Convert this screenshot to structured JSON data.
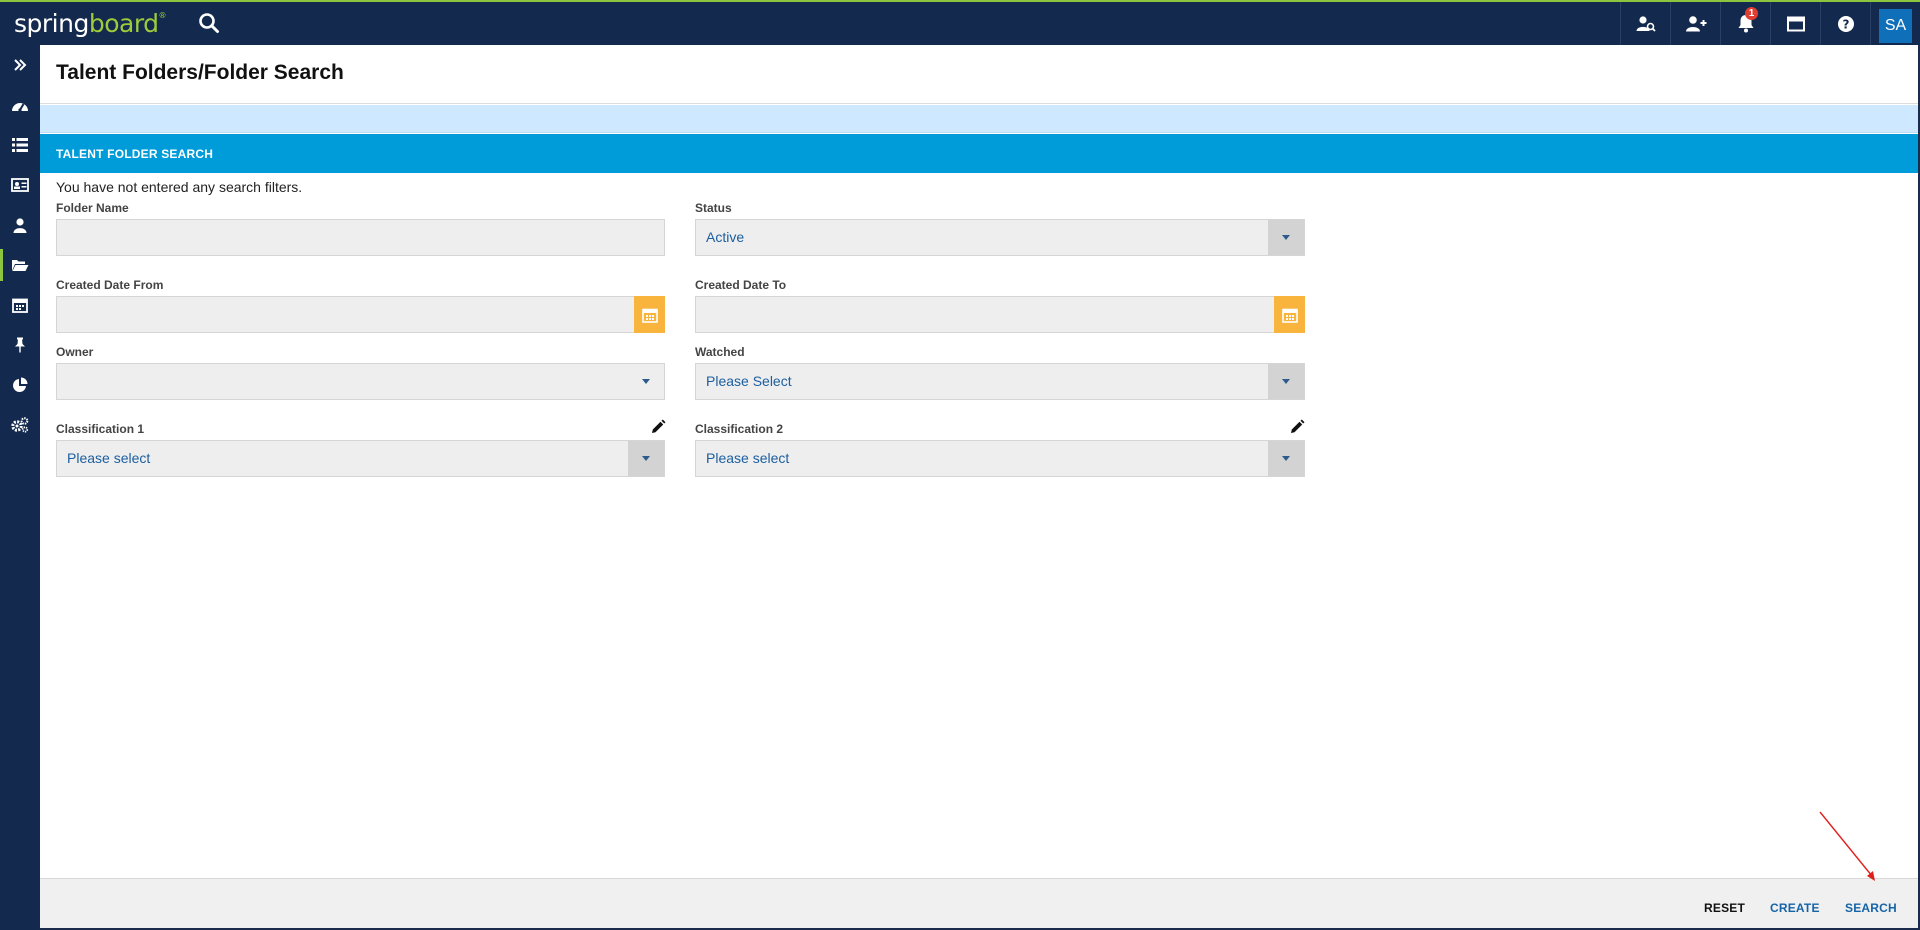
{
  "app": {
    "logo_spring": "spring",
    "logo_board": "board",
    "logo_mark": "®"
  },
  "topbar": {
    "notification_count": "1",
    "avatar_initials": "SA",
    "icons": [
      "user-search-icon",
      "add-user-icon",
      "bell-icon",
      "window-icon",
      "help-icon"
    ]
  },
  "sidebar": {
    "items": [
      "expand-icon",
      "dashboard-icon",
      "list-icon",
      "id-card-icon",
      "person-icon",
      "folder-open-icon",
      "calendar-icon",
      "pin-icon",
      "pie-chart-icon",
      "settings-icon"
    ],
    "active_item": "folder-open-icon"
  },
  "page": {
    "title": "Talent Folders/Folder Search"
  },
  "section": {
    "title": "TALENT FOLDER SEARCH",
    "hint": "You have not entered any search filters."
  },
  "form": {
    "folder_name": {
      "label": "Folder Name",
      "value": ""
    },
    "status": {
      "label": "Status",
      "value": "Active"
    },
    "created_from": {
      "label": "Created Date From",
      "value": ""
    },
    "created_to": {
      "label": "Created Date To",
      "value": ""
    },
    "owner": {
      "label": "Owner",
      "value": ""
    },
    "watched": {
      "label": "Watched",
      "value": "Please Select"
    },
    "classification1": {
      "label": "Classification 1",
      "value": "Please select"
    },
    "classification2": {
      "label": "Classification 2",
      "value": "Please select"
    }
  },
  "footer": {
    "reset": "RESET",
    "create": "CREATE",
    "search": "SEARCH"
  },
  "colors": {
    "topbar": "#132a4e",
    "accent_green": "#8cc63f",
    "section_blue": "#009bd9",
    "calendar_orange": "#f8b43c",
    "link_blue": "#1664a8"
  }
}
